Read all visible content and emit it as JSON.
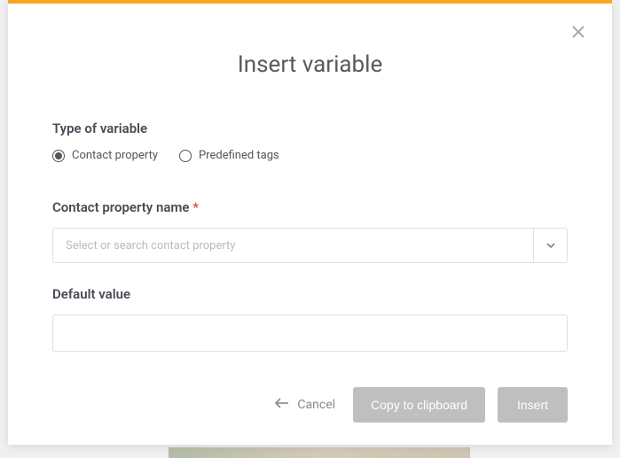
{
  "title": "Insert variable",
  "typeSection": {
    "label": "Type of variable",
    "options": {
      "contact": "Contact property",
      "predefined": "Predefined tags"
    }
  },
  "propertyField": {
    "label": "Contact property name ",
    "requiredMark": "*",
    "placeholder": "Select or search contact property"
  },
  "defaultField": {
    "label": "Default value",
    "value": ""
  },
  "actions": {
    "cancel": "Cancel",
    "copy": "Copy to clipboard",
    "insert": "Insert"
  }
}
